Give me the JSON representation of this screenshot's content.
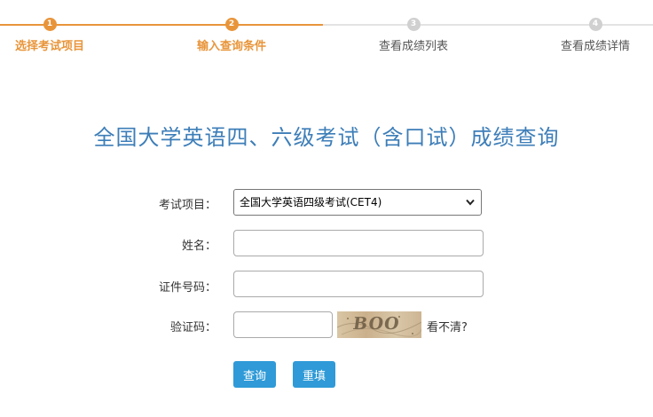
{
  "steps": [
    {
      "num": "1",
      "label": "选择考试项目",
      "state": "active"
    },
    {
      "num": "2",
      "label": "输入查询条件",
      "state": "active"
    },
    {
      "num": "3",
      "label": "查看成绩列表",
      "state": "inactive"
    },
    {
      "num": "4",
      "label": "查看成绩详情",
      "state": "inactive"
    }
  ],
  "page_title": "全国大学英语四、六级考试（含口试）成绩查询",
  "form": {
    "exam_label": "考试项目：",
    "exam_selected": "全国大学英语四级考试(CET4)",
    "name_label": "姓名：",
    "name_value": "",
    "id_label": "证件号码：",
    "id_value": "",
    "captcha_label": "验证码：",
    "captcha_value": "",
    "captcha_image_text": "BOO",
    "refresh_text": "看不清?"
  },
  "buttons": {
    "query": "查询",
    "reset": "重填"
  },
  "colors": {
    "accent_orange": "#e8953a",
    "title_blue": "#3d7eb8",
    "button_blue": "#2f9ad7",
    "inactive_gray": "#d0d0d0"
  }
}
